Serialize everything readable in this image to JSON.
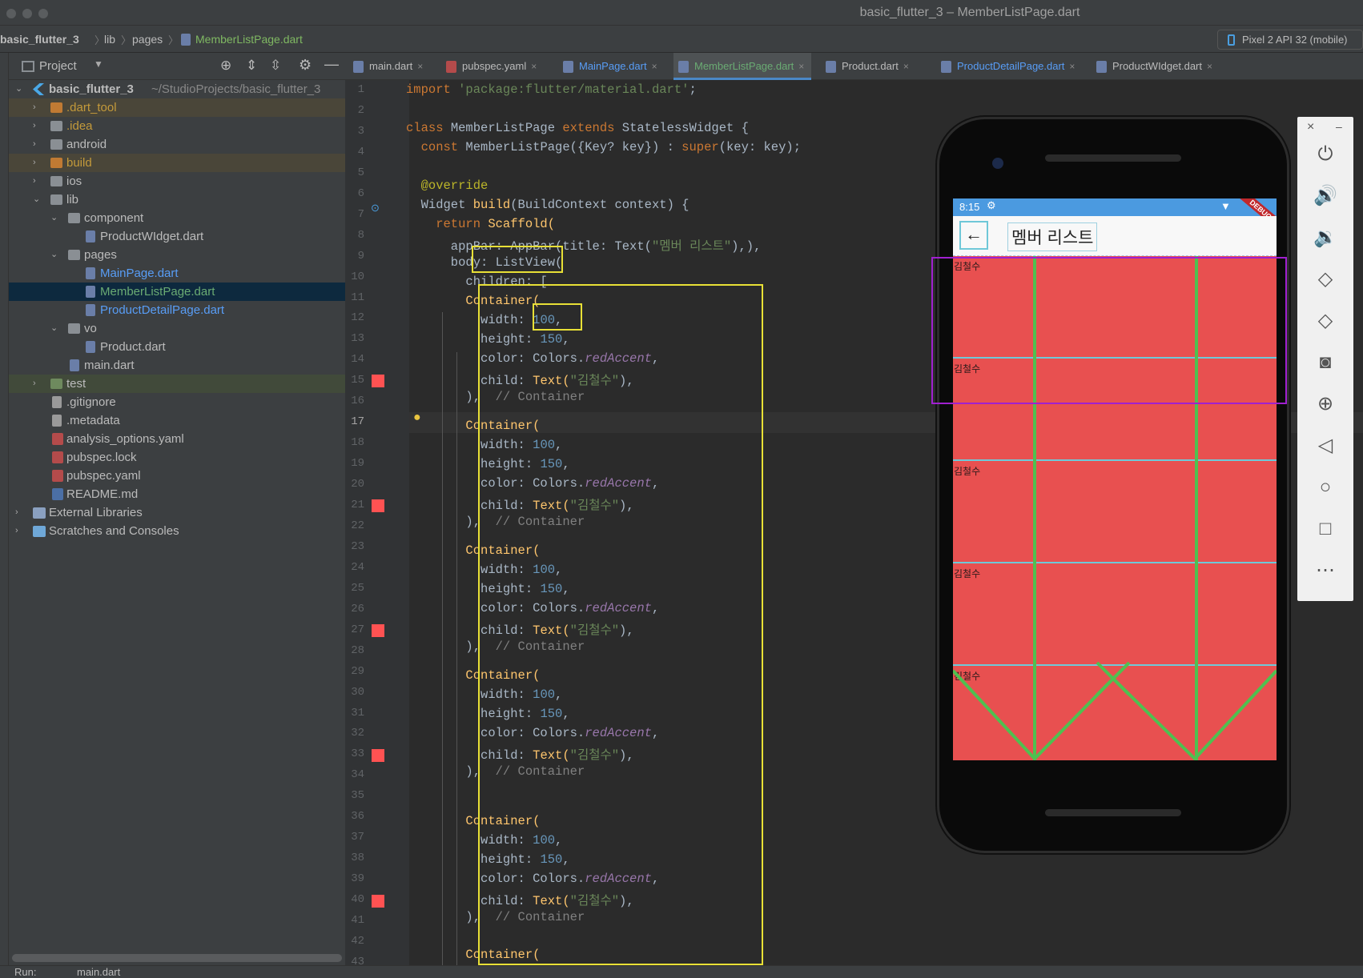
{
  "window": {
    "title": "basic_flutter_3 – MemberListPage.dart"
  },
  "breadcrumb": [
    "basic_flutter_3",
    "lib",
    "pages",
    "MemberListPage.dart"
  ],
  "device_selector": "Pixel 2 API 32 (mobile)",
  "project_panel": {
    "header": "Project",
    "tree": [
      {
        "label": "basic_flutter_3",
        "suffix": "~/StudioProjects/basic_flutter_3"
      },
      {
        "label": ".dart_tool"
      },
      {
        "label": ".idea"
      },
      {
        "label": "android"
      },
      {
        "label": "build"
      },
      {
        "label": "ios"
      },
      {
        "label": "lib"
      },
      {
        "label": "component"
      },
      {
        "label": "ProductWIdget.dart"
      },
      {
        "label": "pages"
      },
      {
        "label": "MainPage.dart"
      },
      {
        "label": "MemberListPage.dart"
      },
      {
        "label": "ProductDetailPage.dart"
      },
      {
        "label": "vo"
      },
      {
        "label": "Product.dart"
      },
      {
        "label": "main.dart"
      },
      {
        "label": "test"
      },
      {
        "label": ".gitignore"
      },
      {
        "label": ".metadata"
      },
      {
        "label": "analysis_options.yaml"
      },
      {
        "label": "pubspec.lock"
      },
      {
        "label": "pubspec.yaml"
      },
      {
        "label": "README.md"
      },
      {
        "label": "External Libraries"
      },
      {
        "label": "Scratches and Consoles"
      }
    ]
  },
  "tabs": [
    "main.dart",
    "pubspec.yaml",
    "MainPage.dart",
    "MemberListPage.dart",
    "Product.dart",
    "ProductDetailPage.dart",
    "ProductWIdget.dart"
  ],
  "tab_close": "×",
  "editor": {
    "current_line": 17,
    "line_numbers": [
      "1",
      "2",
      "3",
      "4",
      "5",
      "6",
      "7",
      "8",
      "9",
      "10",
      "11",
      "12",
      "13",
      "14",
      "15",
      "16",
      "17",
      "18",
      "19",
      "20",
      "21",
      "22",
      "23",
      "24",
      "25",
      "26",
      "27",
      "28",
      "29",
      "30",
      "31",
      "32",
      "33",
      "34",
      "35",
      "36",
      "37",
      "38",
      "39",
      "40",
      "41",
      "42",
      "43"
    ]
  },
  "code": {
    "l1_kw": "import",
    "l1_str": " 'package:flutter/material.dart'",
    "l1_end": ";",
    "l3_kw": "class",
    "l3_a": " MemberListPage ",
    "l3_kw2": "extends",
    "l3_b": " StatelessWidget {",
    "l4_kw": "  const",
    "l4_a": " MemberListPage({Key? key}) : ",
    "l4_kw2": "super",
    "l4_b": "(key: key);",
    "l6_ann": "  @override",
    "l7_a": "  Widget ",
    "l7_fn": "build",
    "l7_b": "(BuildContext context) {",
    "l8_kw": "    return",
    "l8_a": " Scaffold(",
    "l9_a": "      appBar: AppBar(title: Text(",
    "l9_str": "\"멤버 리스트\"",
    "l9_b": "),),",
    "l10_a": "      body: ListView(",
    "l11_a": "        children: [",
    "container": "Container(",
    "width_key": "width: ",
    "width_val": "100",
    "height_key": "height: ",
    "height_val": "150",
    "color_key": "color: Colors.",
    "color_val": "redAccent",
    "child_key": "child: ",
    "child_fn": "Text(",
    "child_str": "\"김철수\"",
    "child_end": "),",
    "close": "),",
    "close_cm": "  // Container"
  },
  "phone": {
    "time": "8:15",
    "debug": "DEBUG",
    "back_icon": "←",
    "app_title": "멤버 리스트",
    "row_label": "김철수",
    "row_count": 5
  },
  "emulator_toolbar": {
    "close": "×",
    "minimize": "–",
    "icons": [
      "power-icon",
      "volume-up-icon",
      "volume-down-icon",
      "rotate-left-icon",
      "rotate-right-icon",
      "camera-icon",
      "zoom-icon",
      "back-icon",
      "home-icon",
      "overview-icon",
      "more-icon"
    ]
  },
  "bottom_bar": {
    "run_label": "Run:",
    "run_config": "main.dart"
  }
}
